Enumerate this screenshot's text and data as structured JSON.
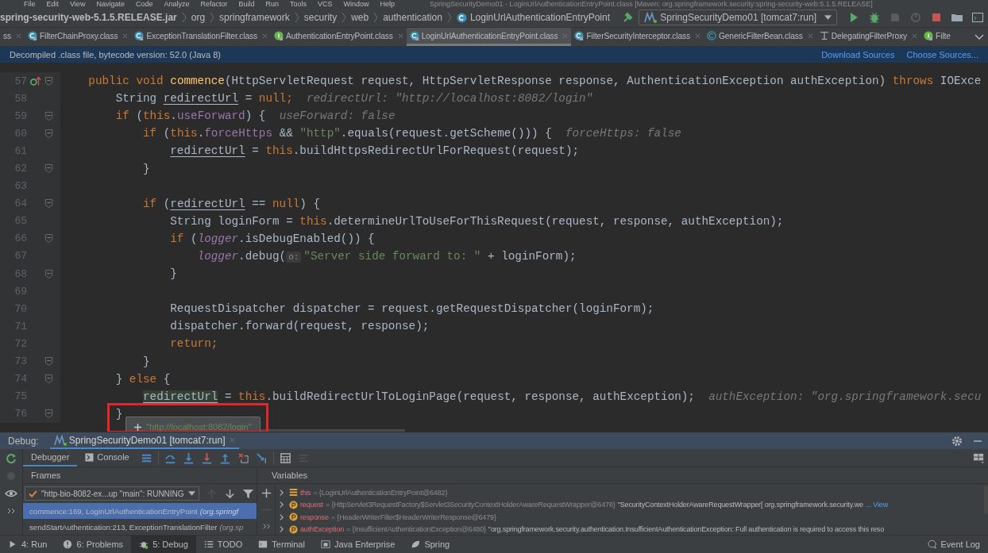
{
  "menu": {
    "items": [
      "File",
      "Edit",
      "View",
      "Navigate",
      "Code",
      "Analyze",
      "Refactor",
      "Build",
      "Run",
      "Tools",
      "VCS",
      "Window",
      "Help"
    ],
    "title": "SpringSecurityDemo01 - LoginUrlAuthenticationEntryPoint.class [Maven: org.springframework.security:spring-security-web:5.1.5.RELEASE]"
  },
  "breadcrumbs": [
    {
      "label": "spring-security-web-5.1.5.RELEASE.jar",
      "kind": "jar"
    },
    {
      "label": "org",
      "kind": "package"
    },
    {
      "label": "springframework",
      "kind": "package"
    },
    {
      "label": "security",
      "kind": "package"
    },
    {
      "label": "web",
      "kind": "package"
    },
    {
      "label": "authentication",
      "kind": "package"
    },
    {
      "label": "LoginUrlAuthenticationEntryPoint",
      "kind": "class"
    }
  ],
  "run_config": "SpringSecurityDemo01 [tomcat7:run]",
  "tabs": [
    {
      "label": "ss",
      "kind": "none",
      "selected": false,
      "closable": true
    },
    {
      "label": "FilterChainProxy.class",
      "kind": "class",
      "selected": false,
      "closable": true
    },
    {
      "label": "ExceptionTranslationFilter.class",
      "kind": "class",
      "selected": false,
      "closable": true
    },
    {
      "label": "AuthenticationEntryPoint.class",
      "kind": "interface",
      "selected": false,
      "closable": true
    },
    {
      "label": "LoginUrlAuthenticationEntryPoint.class",
      "kind": "class",
      "selected": true,
      "closable": true
    },
    {
      "label": "FilterSecurityInterceptor.class",
      "kind": "class",
      "selected": false,
      "closable": true
    },
    {
      "label": "GenericFilterBean.class",
      "kind": "abstract",
      "selected": false,
      "closable": true
    },
    {
      "label": "DelegatingFilterProxy",
      "kind": "other",
      "selected": false,
      "closable": true
    },
    {
      "label": "Filte",
      "kind": "interface",
      "selected": false,
      "closable": false
    }
  ],
  "banner": {
    "text": "Decompiled .class file, bytecode version: 52.0 (Java 8)",
    "links": [
      "Download Sources",
      "Choose Sources..."
    ]
  },
  "code_lines": [
    {
      "number": "57",
      "fold": true,
      "implements": true,
      "tokens": [
        {
          "kind": "k",
          "text": "    public void "
        },
        {
          "kind": "f",
          "text": "commence"
        },
        {
          "kind": "p",
          "text": "(HttpServletRequest request, HttpServletResponse response, AuthenticationException authException) "
        },
        {
          "kind": "k",
          "text": "throws "
        },
        {
          "kind": "p",
          "text": "IOExce"
        }
      ]
    },
    {
      "number": "58",
      "fold": false,
      "tokens": [
        {
          "kind": "p",
          "text": "        String "
        },
        {
          "kind": "v",
          "text": "redirectUrl"
        },
        {
          "kind": "p",
          "text": " = "
        },
        {
          "kind": "k",
          "text": "null;"
        },
        {
          "kind": "h",
          "text": "  redirectUrl: \"http://localhost:8082/login\""
        }
      ]
    },
    {
      "number": "59",
      "fold": true,
      "tokens": [
        {
          "kind": "k",
          "text": "        if "
        },
        {
          "kind": "p",
          "text": "("
        },
        {
          "kind": "k",
          "text": "this"
        },
        {
          "kind": "p",
          "text": "."
        },
        {
          "kind": "fld",
          "text": "useForward"
        },
        {
          "kind": "p",
          "text": ") {"
        },
        {
          "kind": "h",
          "text": "  useForward: false"
        }
      ]
    },
    {
      "number": "60",
      "fold": true,
      "tokens": [
        {
          "kind": "k",
          "text": "            if "
        },
        {
          "kind": "p",
          "text": "("
        },
        {
          "kind": "k",
          "text": "this"
        },
        {
          "kind": "p",
          "text": "."
        },
        {
          "kind": "fld",
          "text": "forceHttps"
        },
        {
          "kind": "p",
          "text": " && "
        },
        {
          "kind": "s",
          "text": "\"http\""
        },
        {
          "kind": "p",
          "text": ".equals(request.getScheme())) {"
        },
        {
          "kind": "h",
          "text": "  forceHttps: false"
        }
      ]
    },
    {
      "number": "61",
      "fold": false,
      "tokens": [
        {
          "kind": "v",
          "text": "                redirectUrl"
        },
        {
          "kind": "p",
          "text": " = "
        },
        {
          "kind": "k",
          "text": "this"
        },
        {
          "kind": "p",
          "text": ".buildHttpsRedirectUrlForRequest(request);"
        }
      ]
    },
    {
      "number": "62",
      "fold": true,
      "tokens": [
        {
          "kind": "p",
          "text": "            }"
        }
      ]
    },
    {
      "number": "63",
      "fold": false
    },
    {
      "number": "64",
      "fold": true,
      "tokens": [
        {
          "kind": "k",
          "text": "            if "
        },
        {
          "kind": "p",
          "text": "("
        },
        {
          "kind": "v",
          "text": "redirectUrl"
        },
        {
          "kind": "p",
          "text": " == "
        },
        {
          "kind": "k",
          "text": "null"
        },
        {
          "kind": "p",
          "text": ") {"
        }
      ]
    },
    {
      "number": "65",
      "fold": false,
      "tokens": [
        {
          "kind": "p",
          "text": "                String loginForm = "
        },
        {
          "kind": "k",
          "text": "this"
        },
        {
          "kind": "p",
          "text": ".determineUrlToUseForThisRequest(request, response, authException);"
        }
      ]
    },
    {
      "number": "66",
      "fold": true,
      "tokens": [
        {
          "kind": "k",
          "text": "                if "
        },
        {
          "kind": "p",
          "text": "("
        },
        {
          "kind": "st",
          "text": "logger"
        },
        {
          "kind": "p",
          "text": ".isDebugEnabled()) {"
        }
      ]
    },
    {
      "number": "67",
      "fold": false,
      "tokens": [
        {
          "kind": "st",
          "text": "                    logger"
        },
        {
          "kind": "p",
          "text": ".debug("
        },
        {
          "kind": "inl",
          "text": "o:"
        },
        {
          "kind": "s",
          "text": "\"Server side forward to: \""
        },
        {
          "kind": "p",
          "text": " + loginForm);"
        }
      ]
    },
    {
      "number": "68",
      "fold": true,
      "tokens": [
        {
          "kind": "p",
          "text": "                }"
        }
      ]
    },
    {
      "number": "69",
      "fold": false
    },
    {
      "number": "70",
      "fold": false,
      "tokens": [
        {
          "kind": "p",
          "text": "                RequestDispatcher dispatcher = request.getRequestDispatcher(loginForm);"
        }
      ]
    },
    {
      "number": "71",
      "fold": false,
      "tokens": [
        {
          "kind": "p",
          "text": "                dispatcher.forward(request, response);"
        }
      ]
    },
    {
      "number": "72",
      "fold": false,
      "tokens": [
        {
          "kind": "k",
          "text": "                return;"
        }
      ]
    },
    {
      "number": "73",
      "fold": true,
      "tokens": [
        {
          "kind": "p",
          "text": "            }"
        }
      ]
    },
    {
      "number": "74",
      "fold": true,
      "tokens": [
        {
          "kind": "p",
          "text": "        } "
        },
        {
          "kind": "k",
          "text": "else "
        },
        {
          "kind": "p",
          "text": "{"
        }
      ]
    },
    {
      "number": "75",
      "fold": false,
      "tokens": [
        {
          "kind": "sel",
          "text": "            redirectUrl"
        },
        {
          "kind": "p",
          "text": " = "
        },
        {
          "kind": "k",
          "text": "this"
        },
        {
          "kind": "p",
          "text": ".buildRedirectUrlToLoginPage(request, response, authException);"
        },
        {
          "kind": "h",
          "text": "  authException: \"org.springframework.secu"
        }
      ]
    },
    {
      "number": "76",
      "fold": true,
      "tokens": [
        {
          "kind": "p",
          "text": "        }"
        }
      ]
    }
  ],
  "tooltip": {
    "value": "\"http://localhost:8082/login\""
  },
  "debug": {
    "label": "Debug:",
    "session": "SpringSecurityDemo01 [tomcat7:run]",
    "tabs": [
      {
        "label": "Debugger",
        "selected": true
      },
      {
        "label": "Console",
        "selected": false
      }
    ],
    "frames_title": "Frames",
    "variables_title": "Variables",
    "thread": "\"http-bio-8082-ex...up \"main\": RUNNING",
    "frames": [
      {
        "method": "commence:169, LoginUrlAuthenticationEntryPoint",
        "package": "(org.springf",
        "selected": true
      },
      {
        "method": "sendStartAuthentication:213, ExceptionTranslationFilter",
        "package": "(org.sp",
        "selected": false
      }
    ],
    "variables": [
      {
        "kind": "object",
        "name": "this",
        "value": "= {LoginUrlAuthenticationEntryPoint@6482}"
      },
      {
        "kind": "param",
        "name": "request",
        "value": "= {HttpServlet3RequestFactory$Servlet3SecurityContextHolderAwareRequestWrapper@6478}",
        "string": "\"SecurityContextHolderAwareRequestWrapper[ org.springframework.security.we",
        "link": "... View"
      },
      {
        "kind": "param",
        "name": "response",
        "value": "= {HeaderWriterFilter$HeaderWriterResponse@6479}"
      },
      {
        "kind": "param",
        "name": "authException",
        "value": "= {InsufficientAuthenticationException@6480}",
        "string": "\"org.springframework.security.authentication.InsufficientAuthenticationException: Full authentication is required to access this reso"
      }
    ]
  },
  "tool_windows": [
    {
      "label": "4: Run",
      "kind": "run",
      "selected": false
    },
    {
      "label": "6: Problems",
      "kind": "problems",
      "selected": false
    },
    {
      "label": "5: Debug",
      "kind": "debug",
      "selected": true
    },
    {
      "label": "TODO",
      "kind": "todo",
      "selected": false
    },
    {
      "label": "Terminal",
      "kind": "terminal",
      "selected": false
    },
    {
      "label": "Java Enterprise",
      "kind": "enterprise",
      "selected": false
    },
    {
      "label": "Spring",
      "kind": "spring",
      "selected": false
    }
  ],
  "event_log": "Event Log"
}
